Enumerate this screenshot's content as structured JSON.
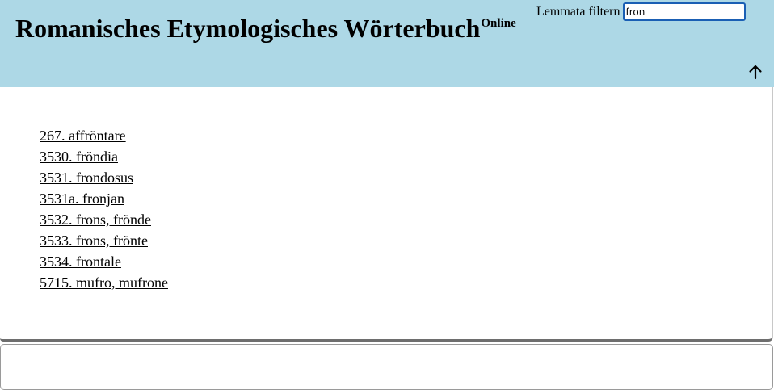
{
  "header": {
    "title": "Romanisches Etymologisches Wörterbuch",
    "title_superscript": "Online",
    "background_color": "#add8e6"
  },
  "filter": {
    "label": "Lemmata filtern",
    "value": "fron"
  },
  "scroll_top": {
    "icon": "arrow-up-icon"
  },
  "results": [
    "267. affrŏntare",
    "3530. frŏndia",
    "3531. frondōsus",
    "3531a. frōnjan",
    "3532. frons, frŏnde",
    "3533. frons, frŏnte",
    "3534. frontāle",
    "5715. mufro, mufrōne"
  ]
}
